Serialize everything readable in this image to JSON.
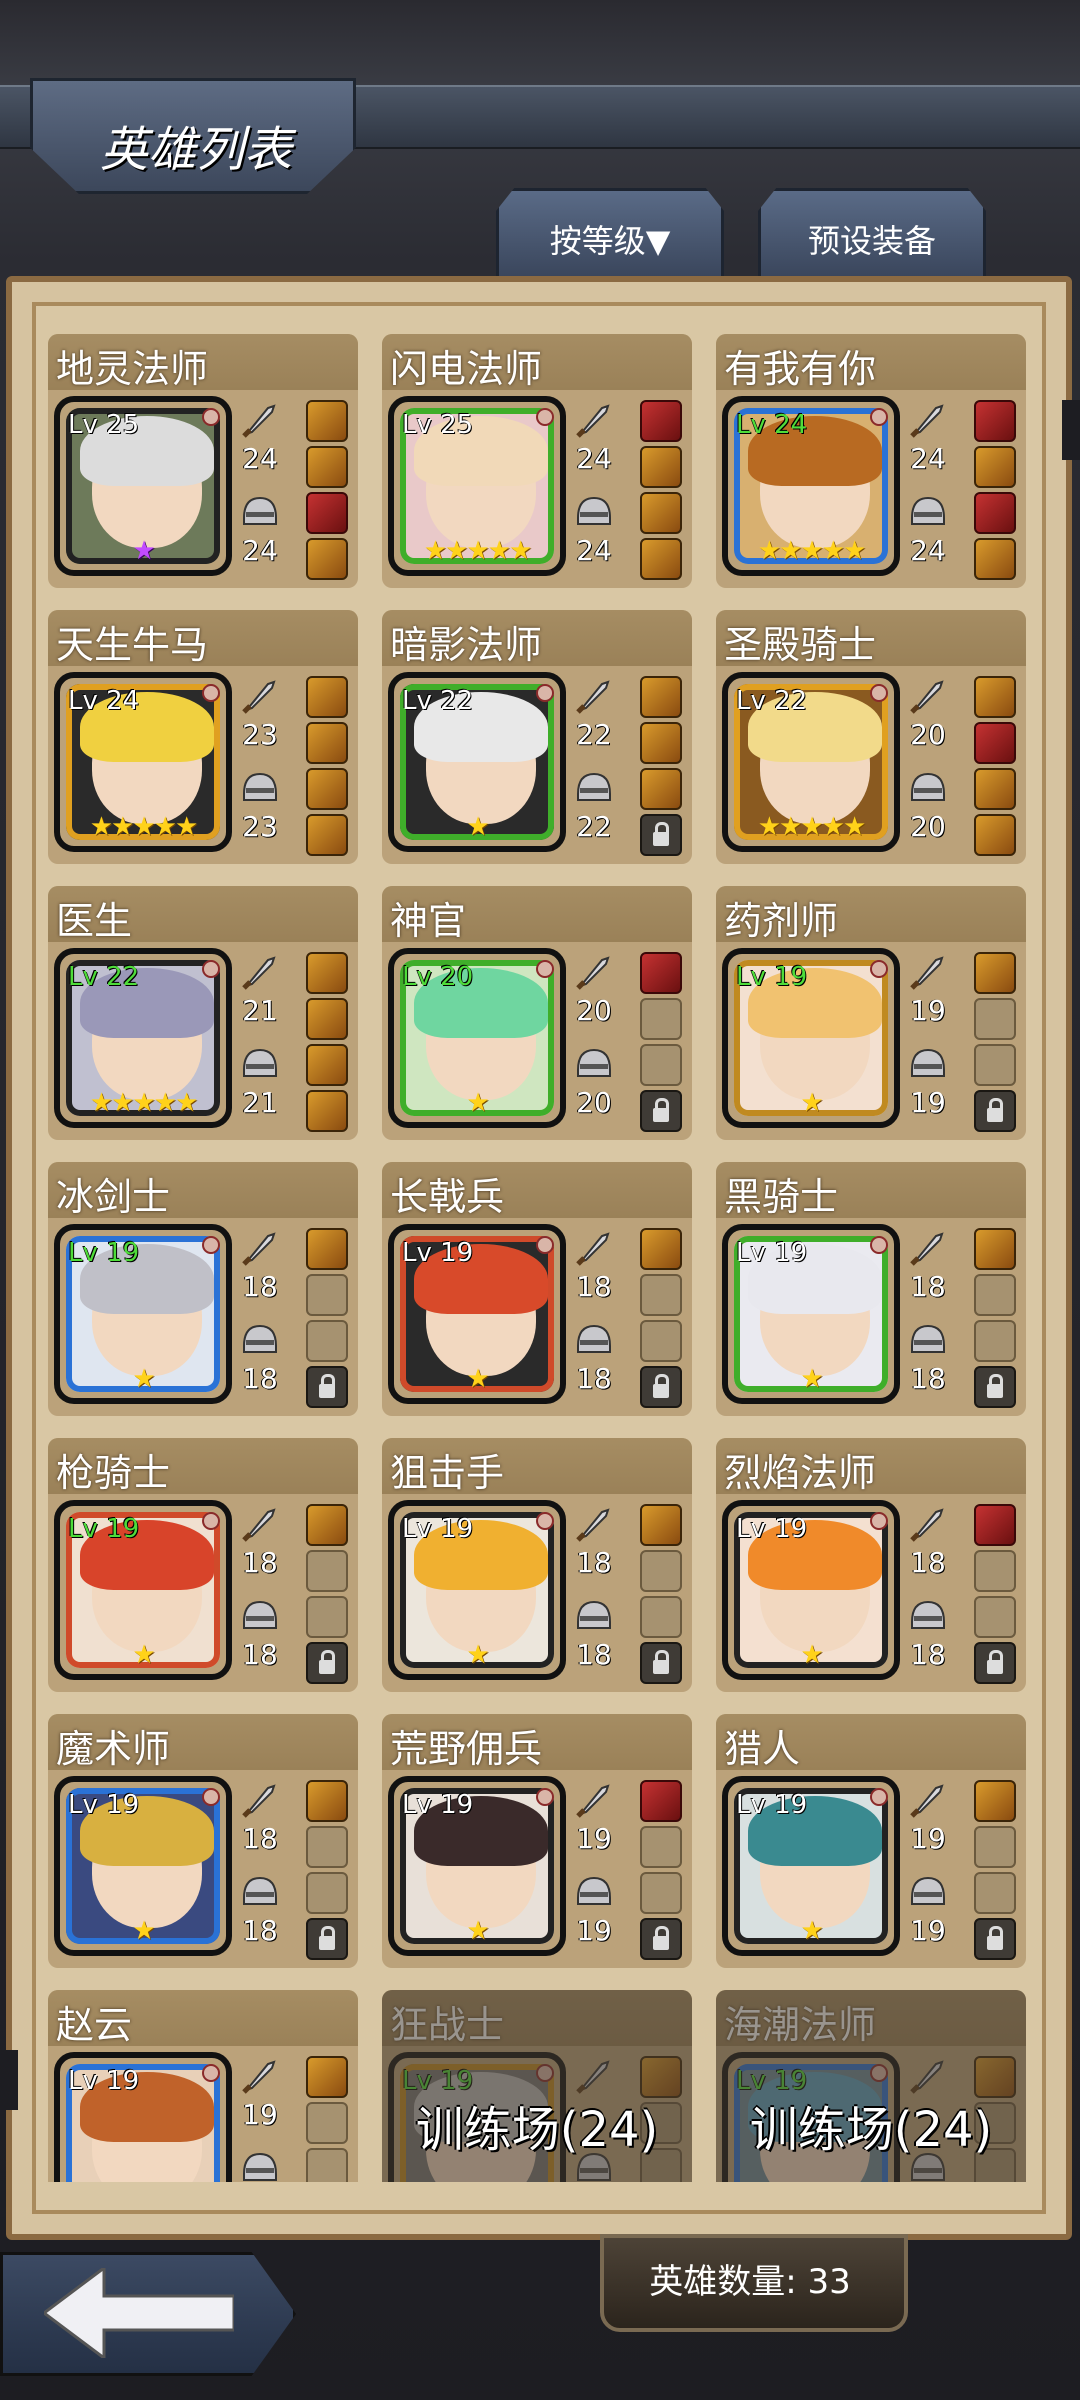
{
  "header": {
    "title": "英雄列表"
  },
  "tabs": [
    {
      "label": "按等级▼"
    },
    {
      "label": "预设装备"
    }
  ],
  "heroes": [
    {
      "name": "地灵法师",
      "level": "Lv 25",
      "lv_green": false,
      "stars": "★",
      "star_color": "purple",
      "atk": "24",
      "def": "24",
      "slots": [
        "filled",
        "filled",
        "red",
        "filled"
      ],
      "hair": "#dcdcdc",
      "frame": "#222222",
      "bg": "#6d7a5a"
    },
    {
      "name": "闪电法师",
      "level": "Lv 25",
      "lv_green": false,
      "stars": "★★★★★",
      "star_color": "gold",
      "atk": "24",
      "def": "24",
      "slots": [
        "red",
        "filled",
        "filled",
        "filled"
      ],
      "hair": "#f1d9b8",
      "frame": "#3fae2a",
      "bg": "#e9c9c9"
    },
    {
      "name": "有我有你",
      "level": "Lv 24",
      "lv_green": true,
      "stars": "★★★★★",
      "star_color": "gold",
      "atk": "24",
      "def": "24",
      "slots": [
        "red",
        "filled",
        "red",
        "filled"
      ],
      "hair": "#b86a22",
      "frame": "#2a72d6",
      "bg": "#d8b070"
    },
    {
      "name": "天生牛马",
      "level": "Lv 24",
      "lv_green": false,
      "stars": "★★★★★",
      "star_color": "gold",
      "atk": "23",
      "def": "23",
      "slots": [
        "filled",
        "filled",
        "filled",
        "filled"
      ],
      "hair": "#f0d040",
      "frame": "#e0a020",
      "bg": "#2a2a2a"
    },
    {
      "name": "暗影法师",
      "level": "Lv 22",
      "lv_green": false,
      "stars": "★",
      "star_color": "gold",
      "atk": "22",
      "def": "22",
      "slots": [
        "filled",
        "filled",
        "filled",
        "lock"
      ],
      "hair": "#e8e8e8",
      "frame": "#3fae2a",
      "bg": "#2a2a2a"
    },
    {
      "name": "圣殿骑士",
      "level": "Lv 22",
      "lv_green": false,
      "stars": "★★★★★",
      "star_color": "gold",
      "atk": "20",
      "def": "20",
      "slots": [
        "filled",
        "red",
        "filled",
        "filled"
      ],
      "hair": "#f2da8a",
      "frame": "#e0a020",
      "bg": "#8a5a20"
    },
    {
      "name": "医生",
      "level": "Lv 22",
      "lv_green": true,
      "stars": "★★★★★",
      "star_color": "gold",
      "atk": "21",
      "def": "21",
      "slots": [
        "filled",
        "filled",
        "filled",
        "filled"
      ],
      "hair": "#9a98b8",
      "frame": "#222222",
      "bg": "#c0c0d0"
    },
    {
      "name": "神官",
      "level": "Lv 20",
      "lv_green": true,
      "stars": "★",
      "star_color": "gold",
      "atk": "20",
      "def": "20",
      "slots": [
        "red",
        "empty",
        "empty",
        "lock"
      ],
      "hair": "#6fd6a0",
      "frame": "#3fae2a",
      "bg": "#cfe6c0"
    },
    {
      "name": "药剂师",
      "level": "Lv 19",
      "lv_green": true,
      "stars": "★",
      "star_color": "gold",
      "atk": "19",
      "def": "19",
      "slots": [
        "filled",
        "empty",
        "empty",
        "lock"
      ],
      "hair": "#f1c270",
      "frame": "#c08a20",
      "bg": "#f3e0d0"
    },
    {
      "name": "冰剑士",
      "level": "Lv 19",
      "lv_green": true,
      "stars": "★",
      "star_color": "gold",
      "atk": "18",
      "def": "18",
      "slots": [
        "filled",
        "empty",
        "empty",
        "lock"
      ],
      "hair": "#c0c0c8",
      "frame": "#2a72d6",
      "bg": "#dfe6f0"
    },
    {
      "name": "长戟兵",
      "level": "Lv 19",
      "lv_green": false,
      "stars": "★",
      "star_color": "gold",
      "atk": "18",
      "def": "18",
      "slots": [
        "filled",
        "empty",
        "empty",
        "lock"
      ],
      "hair": "#d84a2a",
      "frame": "#d04a2a",
      "bg": "#2a2a2a"
    },
    {
      "name": "黑骑士",
      "level": "Lv 19",
      "lv_green": false,
      "stars": "★",
      "star_color": "gold",
      "atk": "18",
      "def": "18",
      "slots": [
        "filled",
        "empty",
        "empty",
        "lock"
      ],
      "hair": "#e8e8ee",
      "frame": "#3fae2a",
      "bg": "#eaeaf0"
    },
    {
      "name": "枪骑士",
      "level": "Lv 19",
      "lv_green": true,
      "stars": "★",
      "star_color": "gold",
      "atk": "18",
      "def": "18",
      "slots": [
        "filled",
        "empty",
        "empty",
        "lock"
      ],
      "hair": "#d8442a",
      "frame": "#d04a2a",
      "bg": "#f0e0d0"
    },
    {
      "name": "狙击手",
      "level": "Lv 19",
      "lv_green": false,
      "stars": "★",
      "star_color": "gold",
      "atk": "18",
      "def": "18",
      "slots": [
        "filled",
        "empty",
        "empty",
        "lock"
      ],
      "hair": "#f0b030",
      "frame": "#222222",
      "bg": "#ece6dc"
    },
    {
      "name": "烈焰法师",
      "level": "Lv 19",
      "lv_green": false,
      "stars": "★",
      "star_color": "gold",
      "atk": "18",
      "def": "18",
      "slots": [
        "red",
        "empty",
        "empty",
        "lock"
      ],
      "hair": "#f08a2a",
      "frame": "#222222",
      "bg": "#f4e0d0"
    },
    {
      "name": "魔术师",
      "level": "Lv 19",
      "lv_green": false,
      "stars": "★",
      "star_color": "gold",
      "atk": "18",
      "def": "18",
      "slots": [
        "filled",
        "empty",
        "empty",
        "lock"
      ],
      "hair": "#d8b040",
      "frame": "#2a72d6",
      "bg": "#3a4a80"
    },
    {
      "name": "荒野佣兵",
      "level": "Lv 19",
      "lv_green": false,
      "stars": "★",
      "star_color": "gold",
      "atk": "19",
      "def": "19",
      "slots": [
        "red",
        "empty",
        "empty",
        "lock"
      ],
      "hair": "#3a2a2a",
      "frame": "#222222",
      "bg": "#e8e0d8"
    },
    {
      "name": "猎人",
      "level": "Lv 19",
      "lv_green": false,
      "stars": "★",
      "star_color": "gold",
      "atk": "19",
      "def": "19",
      "slots": [
        "filled",
        "empty",
        "empty",
        "lock"
      ],
      "hair": "#3a8a90",
      "frame": "#222222",
      "bg": "#d8e0e0"
    },
    {
      "name": "赵云",
      "level": "Lv 19",
      "lv_green": false,
      "stars": "",
      "star_color": "gold",
      "atk": "19",
      "def": "",
      "slots": [
        "filled",
        "empty",
        "empty",
        "empty"
      ],
      "hair": "#c0622a",
      "frame": "#2a72d6",
      "bg": "#e8d0b8"
    },
    {
      "name": "狂战士",
      "level": "Lv 19",
      "lv_green": true,
      "stars": "",
      "star_color": "gold",
      "atk": "",
      "def": "",
      "slots": [
        "filled",
        "empty",
        "empty",
        "empty"
      ],
      "hair": "#bbbbbb",
      "frame": "#c08a20",
      "bg": "#777777",
      "training": "训练场(24)"
    },
    {
      "name": "海潮法师",
      "level": "Lv 19",
      "lv_green": true,
      "stars": "",
      "star_color": "gold",
      "atk": "",
      "def": "",
      "slots": [
        "filled",
        "empty",
        "empty",
        "empty"
      ],
      "hair": "#5aa0c0",
      "frame": "#2a72d6",
      "bg": "#6a8a9a",
      "training": "训练场(24)"
    }
  ],
  "footer": {
    "hero_count": "英雄数量: 33"
  },
  "colors": {
    "panel": "#d6c3a0",
    "card": "#bba27a",
    "level_green": "#4fdc3a",
    "star_gold": "#ffd21a"
  }
}
